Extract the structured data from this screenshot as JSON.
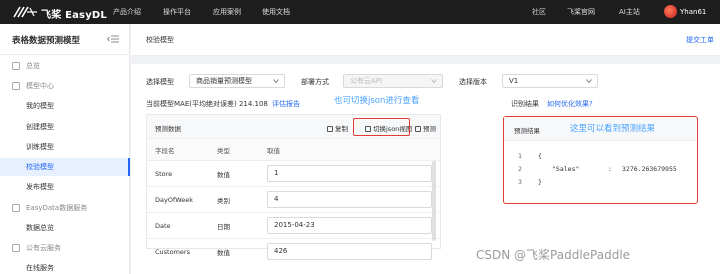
{
  "header": {
    "brand": "飞桨 EasyDL",
    "nav": [
      "产品介绍",
      "操作平台",
      "应用案例",
      "使用文档"
    ],
    "right_nav": [
      "社区",
      "飞桨官网",
      "AI主站"
    ],
    "user": "Yhan61"
  },
  "sidebar": {
    "title": "表格数据预测模型",
    "items": [
      {
        "label": "总览",
        "type": "group"
      },
      {
        "label": "模型中心",
        "type": "group"
      },
      {
        "label": "我的模型",
        "type": "child"
      },
      {
        "label": "创建模型",
        "type": "child"
      },
      {
        "label": "训练模型",
        "type": "child"
      },
      {
        "label": "校验模型",
        "type": "child",
        "active": true
      },
      {
        "label": "发布模型",
        "type": "child"
      },
      {
        "label": "EasyData数据服务",
        "type": "group"
      },
      {
        "label": "数据总览",
        "type": "child"
      },
      {
        "label": "公有云服务",
        "type": "group"
      },
      {
        "label": "在线服务",
        "type": "child"
      }
    ]
  },
  "main": {
    "breadcrumb": "校验模型",
    "ticket_link": "提交工单",
    "select_model_label": "选择模型",
    "select_model_value": "商品销量预测模型",
    "deploy_label": "部署方式",
    "deploy_value": "公有云API",
    "version_label": "选择版本",
    "version_value": "V1",
    "mae_text": "当前模型MAE(平均绝对误差) 214.108",
    "eval_link": "评估报告",
    "annotation_json": "也可切换json进行查看",
    "result_label": "识别结果",
    "optimize_link": "如何优化效果?"
  },
  "data_card": {
    "title": "预测数据",
    "copy": "复制",
    "switch_json": "切换json视图",
    "predict": "预测",
    "columns": [
      "字段名",
      "类型",
      "取值"
    ],
    "rows": [
      {
        "name": "Store",
        "type": "数值",
        "value": "1"
      },
      {
        "name": "DayOfWeek",
        "type": "类别",
        "value": "4"
      },
      {
        "name": "Date",
        "type": "日期",
        "value": "2015-04-23"
      },
      {
        "name": "Customers",
        "type": "数值",
        "value": "426"
      }
    ]
  },
  "result_card": {
    "title": "预测结果",
    "annotation": "这里可以看到预测结果",
    "lines": [
      {
        "n": "1",
        "text": "{"
      },
      {
        "n": "2",
        "key": "\"Sales\"",
        "sep": ":",
        "val": "3276.263679955"
      },
      {
        "n": "3",
        "text": "}"
      }
    ]
  },
  "watermark": "CSDN @飞桨PaddlePaddle",
  "colors": {
    "accent": "#2468f2",
    "highlight": "#e53935",
    "annotation": "#4aa3ff",
    "topbar": "#1e1e1e"
  }
}
